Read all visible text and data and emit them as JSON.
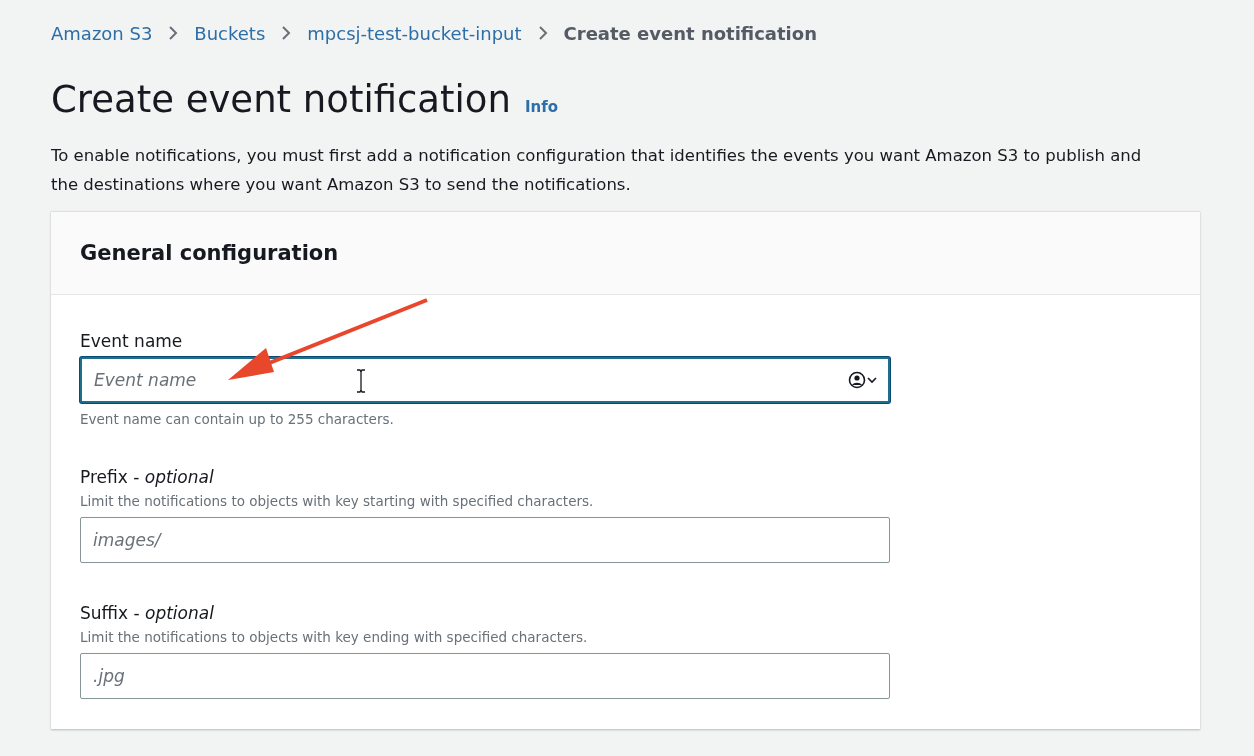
{
  "breadcrumbs": [
    {
      "label": "Amazon S3",
      "link": true
    },
    {
      "label": "Buckets",
      "link": true
    },
    {
      "label": "mpcsj-test-bucket-input",
      "link": true
    },
    {
      "label": "Create event notification",
      "link": false
    }
  ],
  "page": {
    "title": "Create event notification",
    "info_link": "Info",
    "description": "To enable notifications, you must first add a notification configuration that identifies the events you want Amazon S3 to publish and the destinations where you want Amazon S3 to send the notifications."
  },
  "panel": {
    "title": "General configuration",
    "fields": [
      {
        "label": "Event name",
        "placeholder": "Event name",
        "constraint": "Event name can contain up to 255 characters.",
        "focused": true,
        "autofill_icon": true
      },
      {
        "label": "Prefix - *optional*",
        "description": "Limit the notifications to objects with key starting with specified characters.",
        "placeholder": "images/",
        "focused": false,
        "autofill_icon": false
      },
      {
        "label": "Suffix - *optional*",
        "description": "Limit the notifications to objects with key ending with specified characters.",
        "placeholder": ".jpg",
        "focused": false,
        "autofill_icon": false
      }
    ]
  }
}
